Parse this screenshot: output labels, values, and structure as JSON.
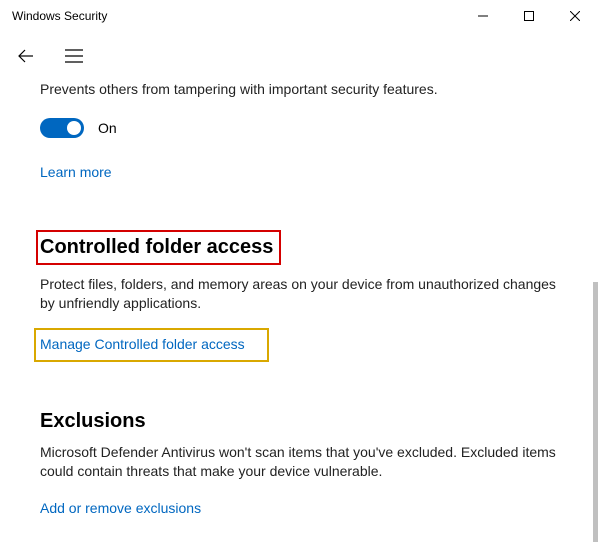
{
  "window": {
    "title": "Windows Security"
  },
  "tamper": {
    "description": "Prevents others from tampering with important security features.",
    "toggle_state": "On",
    "learn_more": "Learn more"
  },
  "cfa": {
    "title": "Controlled folder access",
    "description": "Protect files, folders, and memory areas on your device from unauthorized changes by unfriendly applications.",
    "manage_link": "Manage Controlled folder access"
  },
  "exclusions": {
    "title": "Exclusions",
    "description": "Microsoft Defender Antivirus won't scan items that you've excluded. Excluded items could contain threats that make your device vulnerable.",
    "link": "Add or remove exclusions"
  }
}
